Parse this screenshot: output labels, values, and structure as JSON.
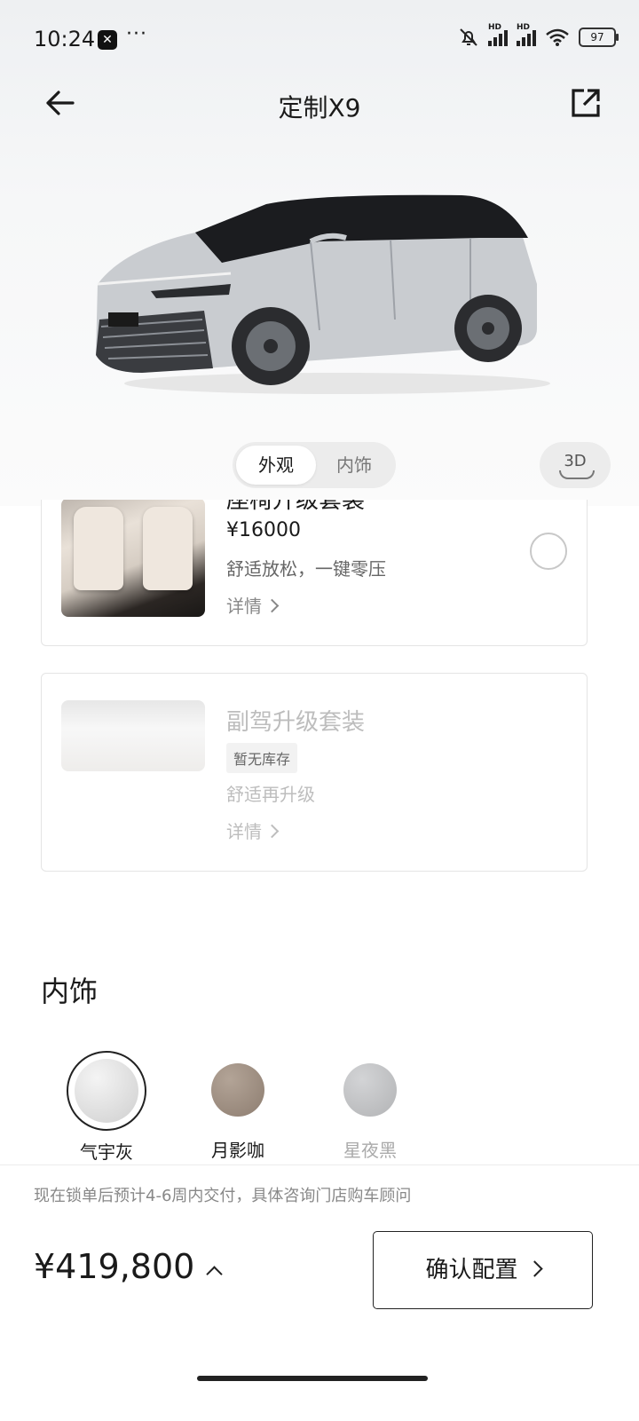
{
  "status_bar": {
    "time": "10:24",
    "more": "···",
    "battery": "97"
  },
  "nav": {
    "title": "定制X9"
  },
  "view_toggle": {
    "exterior": "外观",
    "interior": "内饰",
    "three_d": "3D"
  },
  "options": [
    {
      "title": "座椅升级套装",
      "price": "¥16000",
      "desc": "舒适放松，一键零压",
      "details": "详情",
      "selected": false
    },
    {
      "title": "副驾升级套装",
      "badge": "暂无库存",
      "desc": "舒适再升级",
      "details": "详情"
    }
  ],
  "interior": {
    "title": "内饰",
    "swatches": [
      {
        "label": "气宇灰",
        "color": "#d9d9d9",
        "selected": true
      },
      {
        "label": "月影咖",
        "color": "#9b8b7e",
        "selected": false
      },
      {
        "label": "星夜黑",
        "color": "#bdbec0",
        "selected": false
      }
    ]
  },
  "footer": {
    "notice": "现在锁单后预计4-6周内交付，具体咨询门店购车顾问",
    "total": "¥419,800",
    "confirm": "确认配置"
  }
}
